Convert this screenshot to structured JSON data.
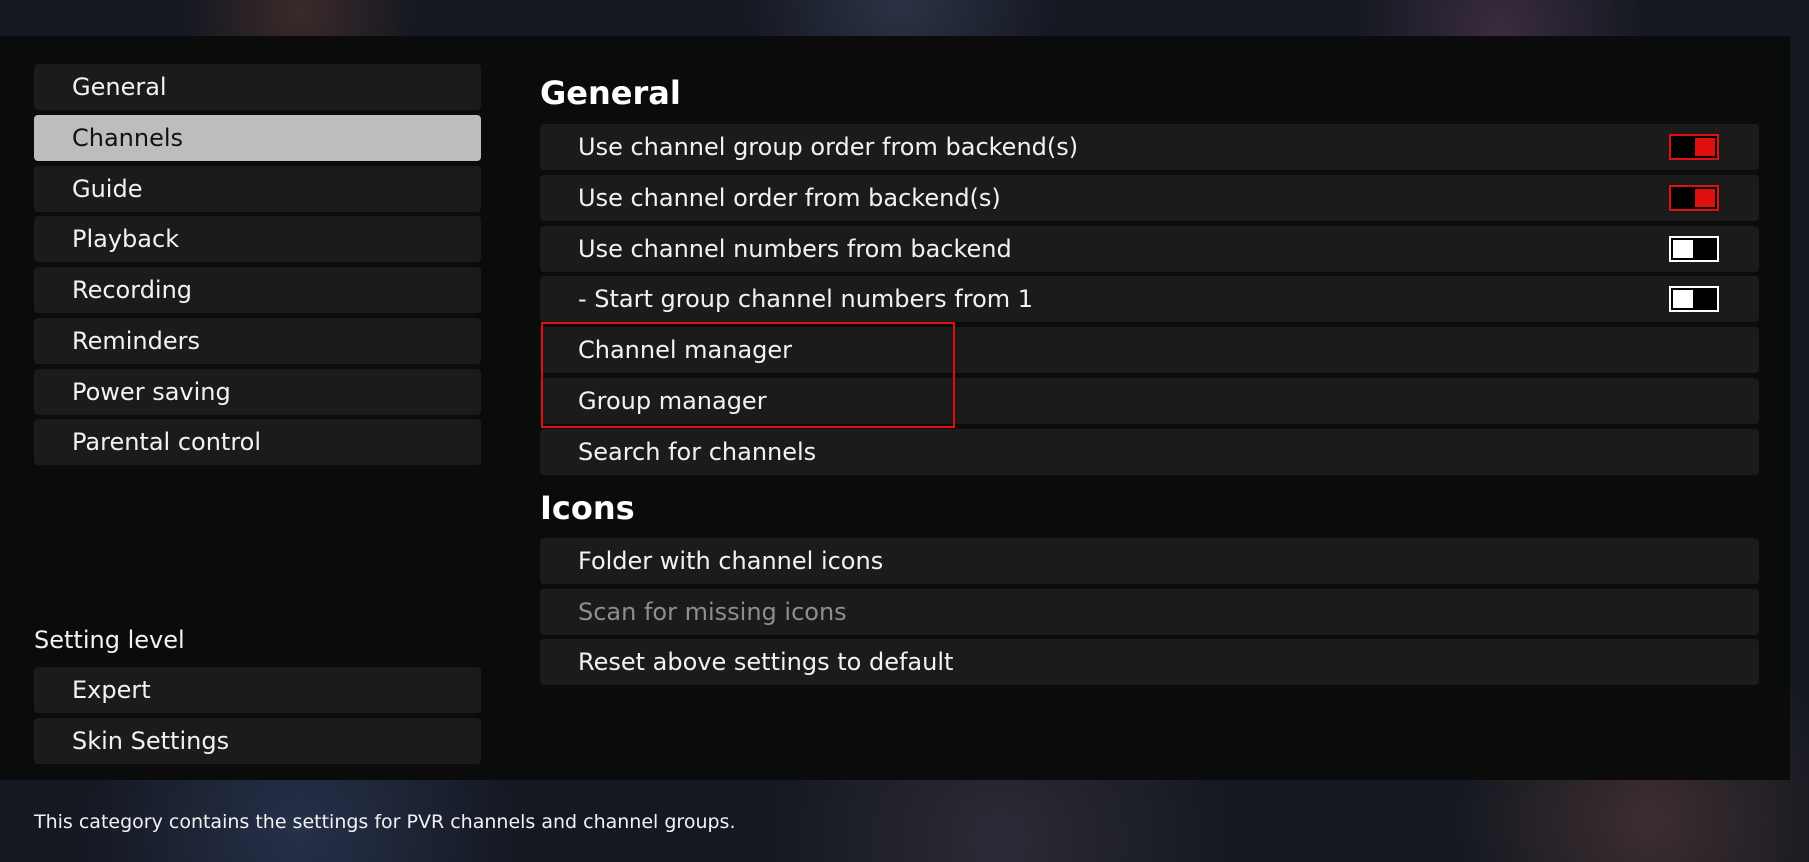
{
  "sidebar": {
    "items": [
      {
        "label": "General"
      },
      {
        "label": "Channels"
      },
      {
        "label": "Guide"
      },
      {
        "label": "Playback"
      },
      {
        "label": "Recording"
      },
      {
        "label": "Reminders"
      },
      {
        "label": "Power saving"
      },
      {
        "label": "Parental control"
      }
    ],
    "selected": "Channels",
    "setting_level_label": "Setting level",
    "bottom_items": [
      {
        "label": "Expert"
      },
      {
        "label": "Skin Settings"
      }
    ]
  },
  "main": {
    "general": {
      "title": "General",
      "settings": [
        {
          "label": "Use channel group order from backend(s)",
          "toggle": true
        },
        {
          "label": "Use channel order from backend(s)",
          "toggle": true
        },
        {
          "label": "Use channel numbers from backend",
          "toggle": false
        },
        {
          "label": "- Start group channel numbers from 1",
          "toggle": false
        },
        {
          "label": "Channel manager"
        },
        {
          "label": "Group manager"
        },
        {
          "label": "Search for channels"
        }
      ]
    },
    "icons": {
      "title": "Icons",
      "settings": [
        {
          "label": "Folder with channel icons"
        },
        {
          "label": "Scan for missing icons",
          "disabled": true
        },
        {
          "label": "Reset above settings to default"
        }
      ]
    }
  },
  "footer": {
    "description": "This category contains the settings for PVR channels and channel groups."
  },
  "colors": {
    "accent": "#e01010",
    "selected_bg": "#bdbdbd",
    "item_bg": "#1b1b1b"
  }
}
